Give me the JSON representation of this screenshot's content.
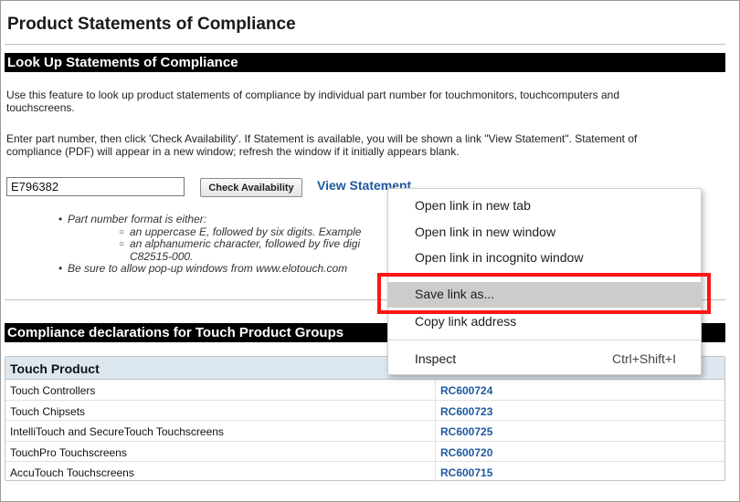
{
  "page": {
    "title": "Product Statements of Compliance"
  },
  "lookup_section": {
    "heading": "Look Up Statements of Compliance",
    "intro_line1a": "Use this feature to look up product statements of compliance by individual part number for touchmonitors, touchcomputers and",
    "intro_line1b": "touchscreens.",
    "intro_line2a": "Enter part number, then click 'Check Availability'. If Statement is available, you will be shown a link \"View Statement\". Statement of",
    "intro_line2b": "compliance (PDF) will appear in a new window; refresh the window if it initially appears blank.",
    "part_number_value": "E796382",
    "check_button_label": "Check Availability",
    "view_statement_label": "View Statement",
    "notes": {
      "format_intro": "Part number format is either:",
      "format_option1": "an uppercase E, followed by six digits. Example",
      "format_option2a": "an alphanumeric character, followed by five digi",
      "format_option2b": "C82515-000.",
      "popup_note": "Be sure to allow pop-up windows from www.elotouch.com"
    }
  },
  "groups_section": {
    "heading": "Compliance declarations for Touch Product Groups",
    "table": {
      "header": "Touch Product",
      "rows": [
        {
          "name": "Touch Controllers",
          "code": "RC600724"
        },
        {
          "name": "Touch Chipsets",
          "code": "RC600723"
        },
        {
          "name": "IntelliTouch and SecureTouch Touchscreens",
          "code": "RC600725"
        },
        {
          "name": "TouchPro Touchscreens",
          "code": "RC600720"
        },
        {
          "name": "AccuTouch Touchscreens",
          "code": "RC600715"
        }
      ]
    }
  },
  "context_menu": {
    "items": [
      {
        "label": "Open link in new tab"
      },
      {
        "label": "Open link in new window"
      },
      {
        "label": "Open link in incognito window"
      },
      {
        "label": "Save link as...",
        "selected": true
      },
      {
        "label": "Copy link address"
      },
      {
        "label": "Inspect",
        "shortcut": "Ctrl+Shift+I"
      }
    ]
  },
  "colors": {
    "section_bar": "#000000",
    "link": "#1f5aa0",
    "table_header": "#dde7f0",
    "menu_selected": "#cccccc",
    "highlight": "#ff1414"
  }
}
